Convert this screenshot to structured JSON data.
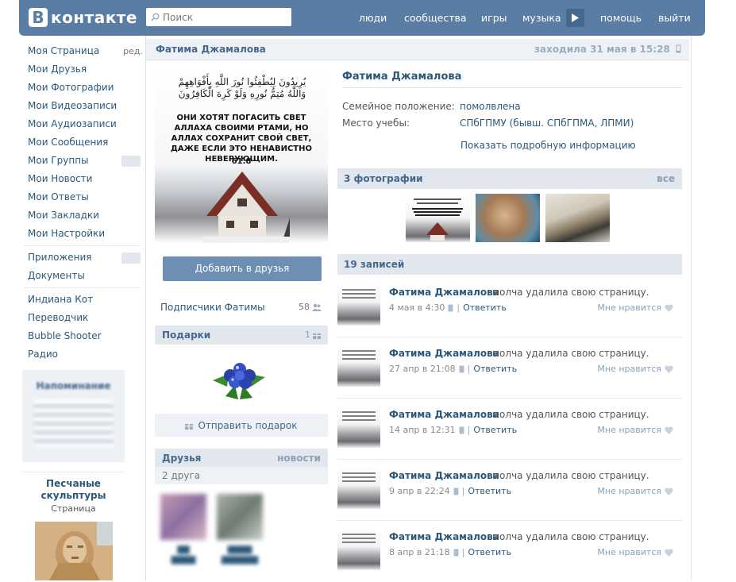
{
  "header": {
    "logo_letter": "B",
    "logo_text": "контакте",
    "search_placeholder": "Поиск",
    "nav": [
      "люди",
      "сообщества",
      "игры",
      "музыка",
      "помощь",
      "выйти"
    ],
    "accent_color": "#597da3"
  },
  "left_menu": {
    "edit_label": "ред.",
    "items": [
      "Моя Страница",
      "Мои Друзья",
      "Мои Фотографии",
      "Мои Видеозаписи",
      "Мои Аудиозаписи",
      "Мои Сообщения",
      "Мои Группы",
      "Мои Новости",
      "Мои Ответы",
      "Мои Закладки",
      "Мои Настройки"
    ],
    "apps": [
      "Приложения",
      "Документы"
    ],
    "games": [
      "Индиана Кот",
      "Переводчик",
      "Bubble Shooter",
      "Радио"
    ],
    "reminder_title": "Напоминание",
    "ad": {
      "title": "Песчаные скульптуры",
      "subtitle": "Страница"
    }
  },
  "profile": {
    "name": "Фатима Джамалова",
    "last_seen": "заходила 31 мая в 15:28",
    "avatar": {
      "arabic": "يُرِيدُونَ لِيُطْفِئُوا نُورَ اللَّهِ بِأَفْوَاهِهِمْ وَاللَّهُ مُتِمُّ نُورِهِ وَلَوْ كَرِهَ الْكَافِرُونَ",
      "text": "ОНИ ХОТЯТ ПОГАСИТЬ СВЕТ АЛЛАХА СВОИМИ РТАМИ, НО АЛЛАХ СОХРАНИТ СВОЙ СВЕТ, ДАЖЕ ЕСЛИ ЭТО НЕНАВИСТНО НЕВЕРУЮЩИМ.",
      "ref": "61:8"
    },
    "add_friend": "Добавить в друзья",
    "subscribers_label": "Подписчики Фатимы",
    "subscribers_count": "58",
    "gifts_title": "Подарки",
    "gifts_count": "1",
    "send_gift": "Отправить подарок",
    "friends_title": "Друзья",
    "friends_link": "новости",
    "friends_count": "2 друга"
  },
  "info": {
    "name": "Фатима Джамалова",
    "rows": [
      {
        "label": "Семейное положение:",
        "value": "помолвлена"
      },
      {
        "label": "Место учебы:",
        "value": "СПбГПМУ (бывш. СПбГПМА, ЛПМИ)"
      }
    ],
    "more": "Показать подробную информацию"
  },
  "photos": {
    "title": "3 фотографии",
    "all": "все"
  },
  "wall": {
    "title": "19 записей",
    "reply": "Ответить",
    "like": "Мне нравится",
    "posts": [
      {
        "author": "Фатима Джамалова",
        "text": "молча удалила свою страницу.",
        "date": "4 мая в 4:30"
      },
      {
        "author": "Фатима Джамалова",
        "text": "молча удалила свою страницу.",
        "date": "27 апр в 21:08"
      },
      {
        "author": "Фатима Джамалова",
        "text": "молча удалила свою страницу.",
        "date": "14 апр в 12:31"
      },
      {
        "author": "Фатима Джамалова",
        "text": "молча удалила свою страницу.",
        "date": "9 апр в 22:24"
      },
      {
        "author": "Фатима Джамалова",
        "text": "молча удалила свою страницу.",
        "date": "8 апр в 21:18"
      }
    ]
  }
}
